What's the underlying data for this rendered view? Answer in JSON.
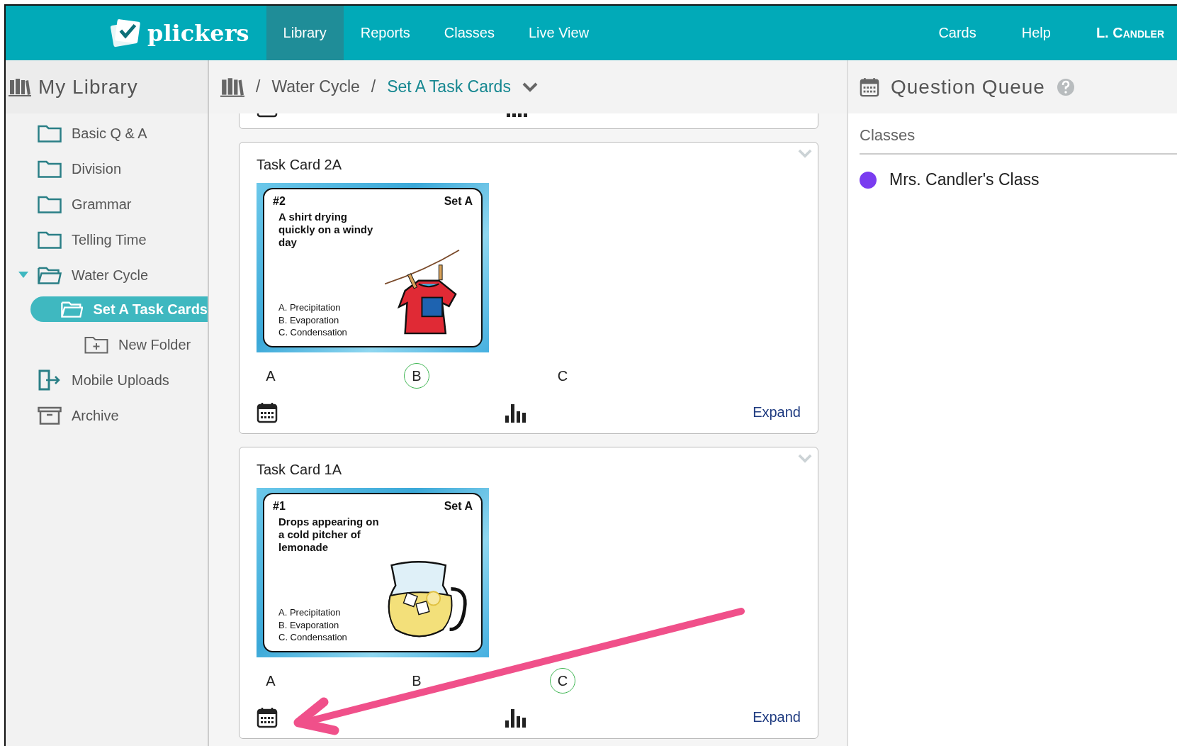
{
  "nav": {
    "brand": "plickers",
    "tabs": [
      {
        "label": "Library",
        "selected": true
      },
      {
        "label": "Reports",
        "selected": false
      },
      {
        "label": "Classes",
        "selected": false
      },
      {
        "label": "Live View",
        "selected": false
      }
    ],
    "links": [
      "Cards",
      "Help"
    ],
    "user": "L. Candler"
  },
  "sidebar": {
    "title": "My Library",
    "items": [
      {
        "label": "Basic Q & A",
        "kind": "folder",
        "selected": false,
        "expanded": false
      },
      {
        "label": "Division",
        "kind": "folder",
        "selected": false,
        "expanded": false
      },
      {
        "label": "Grammar",
        "kind": "folder",
        "selected": false,
        "expanded": false
      },
      {
        "label": "Telling Time",
        "kind": "folder",
        "selected": false,
        "expanded": false
      },
      {
        "label": "Water Cycle",
        "kind": "folder",
        "selected": false,
        "expanded": true,
        "children": [
          {
            "label": "Set A Task Cards",
            "kind": "folder",
            "selected": true,
            "children": [
              {
                "label": "New Folder",
                "kind": "new-folder",
                "selected": false
              }
            ]
          }
        ]
      },
      {
        "label": "Mobile Uploads",
        "kind": "uploads",
        "selected": false
      },
      {
        "label": "Archive",
        "kind": "archive",
        "selected": false
      }
    ]
  },
  "breadcrumb": [
    {
      "separator": "/",
      "label": "Water Cycle",
      "selected": false
    },
    {
      "separator": "/",
      "label": "Set A Task Cards",
      "selected": true
    }
  ],
  "questions": [
    {
      "kind": "partial"
    },
    {
      "kind": "full",
      "title": "Task Card 2A",
      "image": {
        "number": "#2",
        "set": "Set A",
        "question": "A shirt drying quickly on a windy day",
        "options": [
          "A. Precipitation",
          "B. Evaporation",
          "C. Condensation"
        ],
        "kind": "shirt"
      },
      "choices": [
        {
          "letter": "A",
          "correct": false
        },
        {
          "letter": "B",
          "correct": true
        },
        {
          "letter": "C",
          "correct": false
        }
      ],
      "expand": "Expand"
    },
    {
      "kind": "full",
      "title": "Task Card 1A",
      "image": {
        "number": "#1",
        "set": "Set A",
        "question": "Drops appearing on a cold pitcher of lemonade",
        "options": [
          "A. Precipitation",
          "B. Evaporation",
          "C. Condensation"
        ],
        "kind": "pitcher"
      },
      "choices": [
        {
          "letter": "A",
          "correct": false
        },
        {
          "letter": "B",
          "correct": false
        },
        {
          "letter": "C",
          "correct": true
        }
      ],
      "expand": "Expand"
    }
  ],
  "queue": {
    "title": "Question Queue",
    "section": "Classes",
    "classes": [
      {
        "name": "Mrs. Candler's Class",
        "color": "#7a3cf0"
      }
    ]
  }
}
